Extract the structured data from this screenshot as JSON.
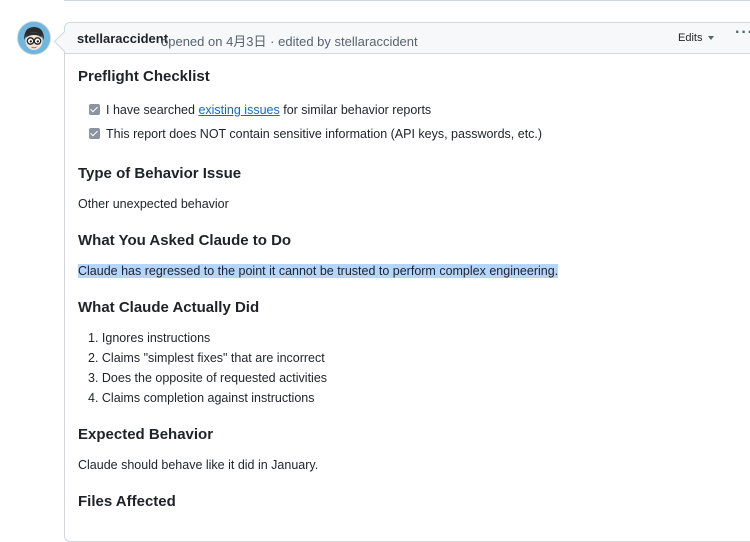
{
  "comment": {
    "author": "stellaraccident",
    "opened_text": "opened on",
    "date": "4月3日",
    "separator": "·",
    "edited_text": "edited by",
    "editor": "stellaraccident",
    "edits_label": "Edits",
    "more_label": "···"
  },
  "sections": {
    "preflight": {
      "heading": "Preflight Checklist",
      "item1_before": "I have searched",
      "item1_link": "existing issues",
      "item1_after": "for similar behavior reports",
      "item2": "This report does NOT contain sensitive information (API keys, passwords, etc.)"
    },
    "type": {
      "heading": "Type of Behavior Issue",
      "text": "Other unexpected behavior"
    },
    "asked": {
      "heading": "What You Asked Claude to Do",
      "text": "Claude has regressed to the point it cannot be trusted to perform complex engineering."
    },
    "did": {
      "heading": "What Claude Actually Did",
      "items": [
        "1. Ignores instructions",
        "2. Claims \"simplest fixes\" that are incorrect",
        "3. Does the opposite of requested activities",
        "4. Claims completion against instructions"
      ]
    },
    "expected": {
      "heading": "Expected Behavior",
      "text": "Claude should behave like it did in January."
    },
    "files": {
      "heading": "Files Affected"
    }
  }
}
